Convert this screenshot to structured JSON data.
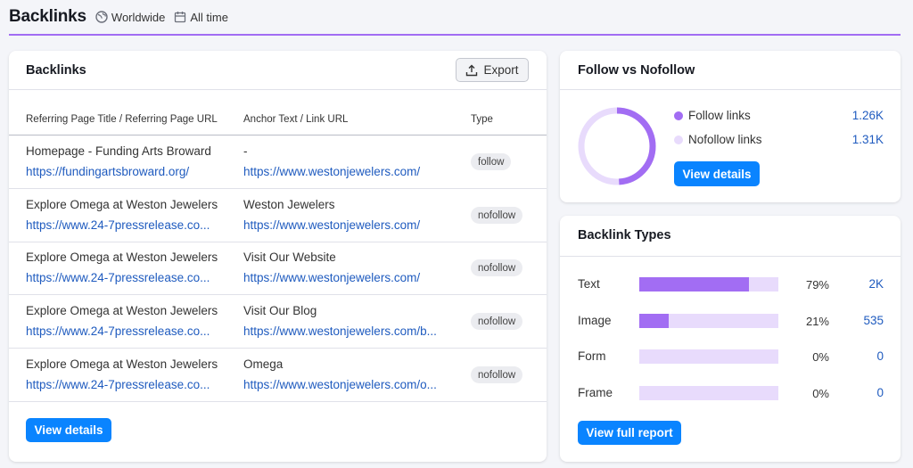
{
  "header": {
    "title": "Backlinks",
    "region": "Worldwide",
    "period": "All time"
  },
  "backlinks": {
    "title": "Backlinks",
    "export_label": "Export",
    "columns": [
      "Referring Page Title / Referring Page URL",
      "Anchor Text / Link URL",
      "Type"
    ],
    "rows": [
      {
        "title": "Homepage - Funding Arts Broward",
        "url": "https://fundingartsbroward.org/",
        "anchor": "-",
        "link": "https://www.westonjewelers.com/",
        "type": "follow"
      },
      {
        "title": "Explore Omega at Weston Jewelers",
        "url": "https://www.24-7pressrelease.co...",
        "anchor": "Weston Jewelers",
        "link": "https://www.westonjewelers.com/",
        "type": "nofollow"
      },
      {
        "title": "Explore Omega at Weston Jewelers",
        "url": "https://www.24-7pressrelease.co...",
        "anchor": "Visit Our Website",
        "link": "https://www.westonjewelers.com/",
        "type": "nofollow"
      },
      {
        "title": "Explore Omega at Weston Jewelers",
        "url": "https://www.24-7pressrelease.co...",
        "anchor": "Visit Our Blog",
        "link": "https://www.westonjewelers.com/b...",
        "type": "nofollow"
      },
      {
        "title": "Explore Omega at Weston Jewelers",
        "url": "https://www.24-7pressrelease.co...",
        "anchor": "Omega",
        "link": "https://www.westonjewelers.com/o...",
        "type": "nofollow"
      }
    ],
    "view_details_label": "View details"
  },
  "follow": {
    "title": "Follow vs Nofollow",
    "items": [
      {
        "label": "Follow links",
        "value": "1.26K",
        "color": "#a26df3",
        "share": 0.49
      },
      {
        "label": "Nofollow links",
        "value": "1.31K",
        "color": "#e8dbfc",
        "share": 0.51
      }
    ],
    "view_details_label": "View details"
  },
  "types": {
    "title": "Backlink Types",
    "items": [
      {
        "label": "Text",
        "pct": "79%",
        "count": "2K",
        "fraction": 0.79
      },
      {
        "label": "Image",
        "pct": "21%",
        "count": "535",
        "fraction": 0.21
      },
      {
        "label": "Form",
        "pct": "0%",
        "count": "0",
        "fraction": 0
      },
      {
        "label": "Frame",
        "pct": "0%",
        "count": "0",
        "fraction": 0
      }
    ],
    "view_report_label": "View full report"
  },
  "colors": {
    "accent": "#a26df3",
    "accent_light": "#e8dbfc",
    "button": "#0a84ff",
    "link": "#1f5bbf"
  }
}
